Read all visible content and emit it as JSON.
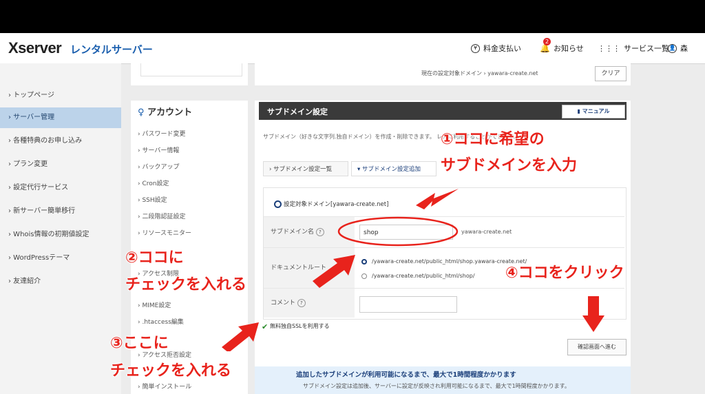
{
  "header": {
    "logo": "Xserver",
    "logo_sub": "レンタルサーバー",
    "nav": [
      "料金支払い",
      "お知らせ",
      "サービス一覧",
      "森"
    ],
    "notification_count": "2"
  },
  "sidebar": {
    "items": [
      {
        "label": "› トップページ"
      },
      {
        "label": "› サーバー管理",
        "active": true
      },
      {
        "label": "› 各種特典のお申し込み"
      },
      {
        "label": "› プラン変更"
      },
      {
        "label": "› 設定代行サービス"
      },
      {
        "label": "› 新サーバー簡単移行"
      },
      {
        "label": "› Whois情報の初期値設定"
      },
      {
        "label": "› WordPressテーマ"
      },
      {
        "label": "› 友達紹介"
      }
    ]
  },
  "account": {
    "title": "アカウント",
    "items": [
      "› パスワード変更",
      "› サーバー情報",
      "› バックアップ",
      "› Cron設定",
      "› SSH設定",
      "› 二段階認証設定",
      "› リソースモニター",
      "› アクセス制限",
      "› MIME設定",
      "› .htaccess編集",
      "› アクセス拒否設定",
      "› 簡単インストール"
    ]
  },
  "breadcrumb": {
    "text": "現在の設定対象ドメイン › yawara-create.net",
    "clear": "クリア"
  },
  "panel": {
    "title": "サブドメイン設定",
    "manual": "マニュアル",
    "description": "サブドメイン（好きな文字列.独自ドメイン）を作成・削除できます。 レスに利用することができます。",
    "tabs": [
      "› サブドメイン設定一覧",
      "▾ サブドメイン設定追加"
    ],
    "target_domain": "設定対象ドメイン[yawara-create.net]",
    "fields": {
      "subdomain_label": "サブドメイン名",
      "subdomain_value": "shop",
      "subdomain_suffix": "yawara-create.net",
      "docroot_label": "ドキュメントルート",
      "docroot_option1": "/yawara-create.net/public_html/shop.yawara-create.net/",
      "docroot_option2": "/yawara-create.net/public_html/shop/",
      "comment_label": "コメント"
    },
    "ssl_label": "無料独自SSLを利用する",
    "confirm_button": "確認画面へ進む",
    "notice_line1": "追加したサブドメインが利用可能になるまで、最大で1時間程度かかります",
    "notice_line2": "サブドメイン設定は追加後、サーバーに設定が反映され利用可能になるまで、最大で1時間程度かかります。"
  },
  "annotations": {
    "a1_line1": "①ココに希望の",
    "a1_line2": "サブドメインを入力",
    "a2_line1": "②ココに",
    "a2_line2": "チェックを入れる",
    "a3_line1": "③ここに",
    "a3_line2": "チェックを入れる",
    "a4": "④ココをクリック"
  }
}
